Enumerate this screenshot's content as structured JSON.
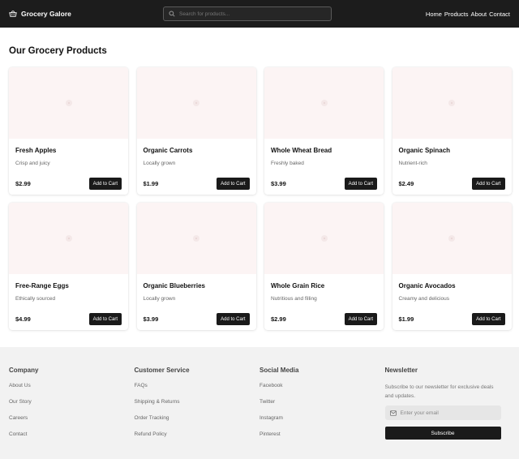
{
  "header": {
    "brand": "Grocery Galore",
    "brand_icon": "basket-icon",
    "search_placeholder": "Search for products...",
    "nav": [
      "Home",
      "Products",
      "About",
      "Contact"
    ]
  },
  "main": {
    "title": "Our Grocery Products",
    "add_label": "Add to Cart",
    "products": [
      {
        "name": "Fresh Apples",
        "desc": "Crisp and juicy",
        "price": "$2.99"
      },
      {
        "name": "Organic Carrots",
        "desc": "Locally grown",
        "price": "$1.99"
      },
      {
        "name": "Whole Wheat Bread",
        "desc": "Freshly baked",
        "price": "$3.99"
      },
      {
        "name": "Organic Spinach",
        "desc": "Nutrient-rich",
        "price": "$2.49"
      },
      {
        "name": "Free-Range Eggs",
        "desc": "Ethically sourced",
        "price": "$4.99"
      },
      {
        "name": "Organic Blueberries",
        "desc": "Locally grown",
        "price": "$3.99"
      },
      {
        "name": "Whole Grain Rice",
        "desc": "Nutritious and filling",
        "price": "$2.99"
      },
      {
        "name": "Organic Avocados",
        "desc": "Creamy and delicious",
        "price": "$1.99"
      }
    ]
  },
  "footer": {
    "company": {
      "title": "Company",
      "links": [
        "About Us",
        "Our Story",
        "Careers",
        "Contact"
      ]
    },
    "service": {
      "title": "Customer Service",
      "links": [
        "FAQs",
        "Shipping & Returns",
        "Order Tracking",
        "Refund Policy"
      ]
    },
    "social": {
      "title": "Social Media",
      "links": [
        "Facebook",
        "Twitter",
        "Instagram",
        "Pinterest"
      ]
    },
    "newsletter": {
      "title": "Newsletter",
      "text": "Subscribe to our newsletter for exclusive deals and updates.",
      "email_placeholder": "Enter your email",
      "button": "Subscribe"
    }
  },
  "colors": {
    "header_bg": "#1c1c1c",
    "button_bg": "#1a1a1a",
    "image_placeholder": "#fcf4f4",
    "footer_bg": "#f2f2f2"
  }
}
